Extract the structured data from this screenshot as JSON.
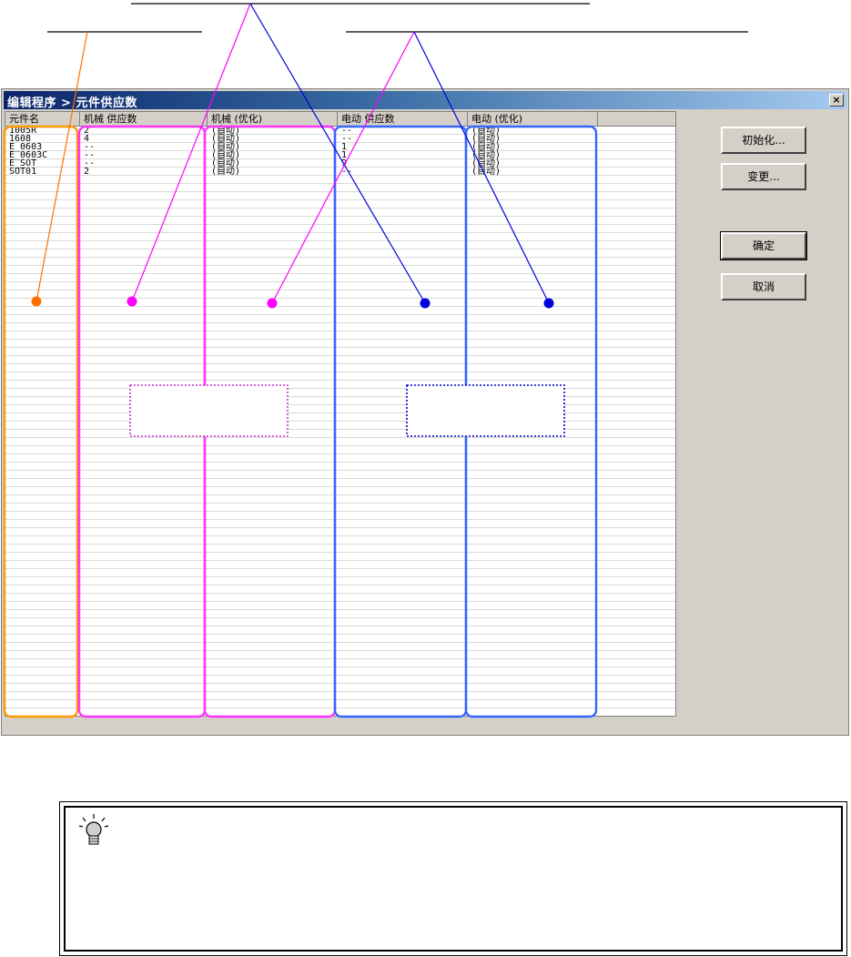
{
  "dialog": {
    "title": "编辑程序 > 元件供应数",
    "close_label": "×"
  },
  "table": {
    "columns": [
      "元件名",
      "机械 供应数",
      "机械 (优化)",
      "电动 供应数",
      "电动 (优化)"
    ],
    "rows": [
      [
        "1005R",
        "2",
        "(自动)",
        "--",
        "(自动)"
      ],
      [
        "1608",
        "4",
        "(自动)",
        "--",
        "(自动)"
      ],
      [
        "E_0603",
        "--",
        "(自动)",
        "1",
        "(自动)"
      ],
      [
        "E_0603C",
        "--",
        "(自动)",
        "1",
        "(自动)"
      ],
      [
        "E_SOT",
        "--",
        "(自动)",
        "9",
        "(自动)"
      ],
      [
        "SOT01",
        "2",
        "(自动)",
        "--",
        "(自动)"
      ]
    ]
  },
  "buttons": {
    "init": "初始化...",
    "change": "变更...",
    "ok": "确定",
    "cancel": "取消"
  },
  "colors": {
    "part_name_group": "#ff8c00",
    "mechanical_group": "#ff00ff",
    "electric_group": "#3366ff",
    "electric_dot": "#0000e0"
  },
  "icons": {
    "tip": "lightbulb-icon"
  }
}
